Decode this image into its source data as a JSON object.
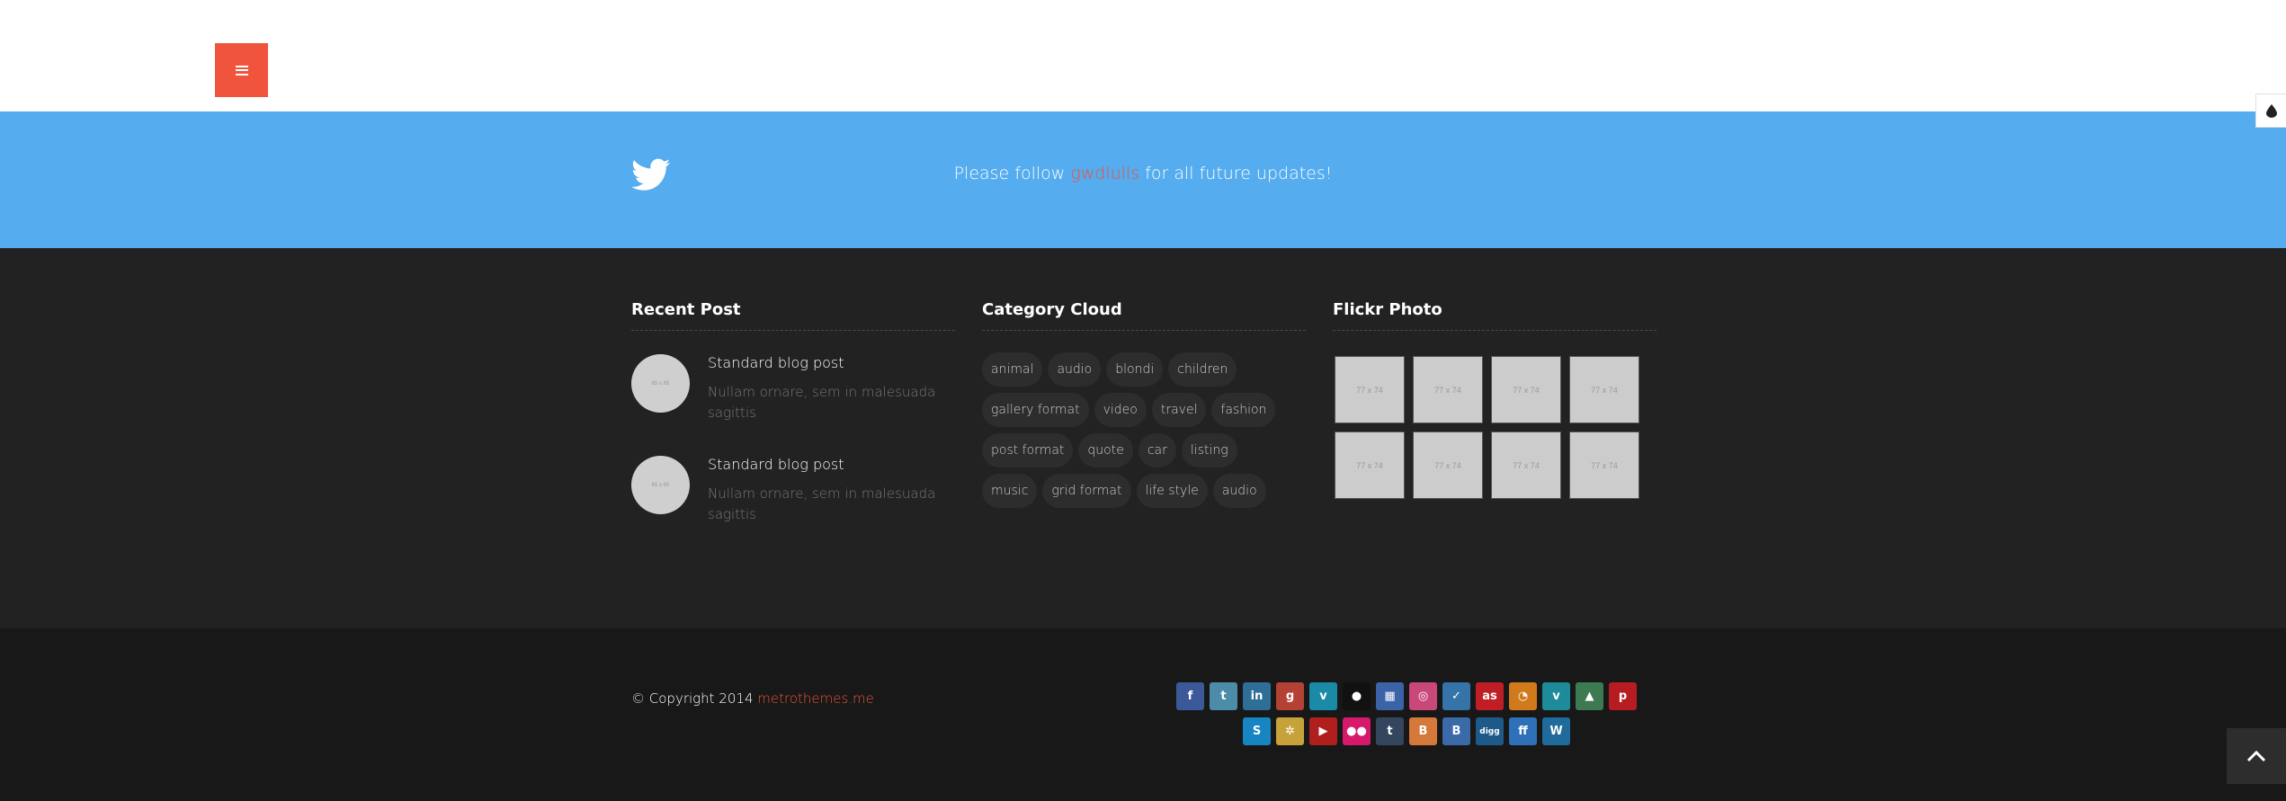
{
  "header": {
    "menu_icon": "hamburger-icon"
  },
  "switcher": {
    "icon": "drop-icon"
  },
  "twitter": {
    "icon": "twitter-bird-icon",
    "text_before": "Please follow ",
    "handle": "gwdlulls",
    "text_after": " for all future updates!"
  },
  "recent_posts": {
    "title": "Recent Post",
    "items": [
      {
        "thumb": "65 x 65",
        "title": "Standard blog post",
        "excerpt": "Nullam ornare, sem in malesuada sagittis"
      },
      {
        "thumb": "65 x 65",
        "title": "Standard blog post",
        "excerpt": "Nullam ornare, sem in malesuada sagittis"
      }
    ]
  },
  "category_cloud": {
    "title": "Category Cloud",
    "tags": [
      "animal",
      "audio",
      "blondi",
      "children",
      "gallery format",
      "video",
      "travel",
      "fashion",
      "post format",
      "quote",
      "car",
      "listing",
      "music",
      "grid format",
      "life style",
      "audio"
    ]
  },
  "flickr": {
    "title": "Flickr Photo",
    "items": [
      "77 x 74",
      "77 x 74",
      "77 x 74",
      "77 x 74",
      "77 x 74",
      "77 x 74",
      "77 x 74",
      "77 x 74"
    ]
  },
  "footer": {
    "copyright": "© Copyright 2014 ",
    "site": "metrothemes.me"
  },
  "social": {
    "row1": [
      {
        "name": "facebook-icon",
        "glyph": "f",
        "color": "#3b5998"
      },
      {
        "name": "twitter-icon",
        "glyph": "t",
        "color": "#4d8ca8"
      },
      {
        "name": "linkedin-icon",
        "glyph": "in",
        "color": "#2f6e96"
      },
      {
        "name": "google-plus-icon",
        "glyph": "g",
        "color": "#b44234"
      },
      {
        "name": "vimeo-icon",
        "glyph": "v",
        "color": "#1a8aa6"
      },
      {
        "name": "github-icon",
        "glyph": "●",
        "color": "#111111"
      },
      {
        "name": "calendar-icon",
        "glyph": "▦",
        "color": "#3a63a8"
      },
      {
        "name": "dribbble-icon",
        "glyph": "◎",
        "color": "#c9487a"
      },
      {
        "name": "foursquare-icon",
        "glyph": "✓",
        "color": "#3574a8"
      },
      {
        "name": "lastfm-icon",
        "glyph": "as",
        "color": "#c01e25"
      },
      {
        "name": "rss-icon",
        "glyph": "◔",
        "color": "#d17a1c"
      },
      {
        "name": "vine-icon",
        "glyph": "v",
        "color": "#1e8b9b"
      },
      {
        "name": "forrst-icon",
        "glyph": "▲",
        "color": "#3d7a52"
      },
      {
        "name": "pinterest-icon",
        "glyph": "p",
        "color": "#b81c23"
      }
    ],
    "row2": [
      {
        "name": "skype-icon",
        "glyph": "S",
        "color": "#1785c1"
      },
      {
        "name": "picasa-icon",
        "glyph": "✲",
        "color": "#c7a23a"
      },
      {
        "name": "youtube-icon",
        "glyph": "▶",
        "color": "#b01e1e"
      },
      {
        "name": "flickr-icon",
        "glyph": "●●",
        "color": "#d6196b"
      },
      {
        "name": "tumblr-icon",
        "glyph": "t",
        "color": "#34465d"
      },
      {
        "name": "blogger-icon",
        "glyph": "B",
        "color": "#d5793a"
      },
      {
        "name": "blogger-alt-icon",
        "glyph": "B",
        "color": "#3a6aa8"
      },
      {
        "name": "digg-icon",
        "glyph": "digg",
        "color": "#1d5a8a"
      },
      {
        "name": "friendfeed-icon",
        "glyph": "ff",
        "color": "#2f71b8"
      },
      {
        "name": "wordpress-icon",
        "glyph": "W",
        "color": "#1e6b9c"
      }
    ]
  },
  "to_top": {
    "icon": "chevron-up-icon"
  }
}
